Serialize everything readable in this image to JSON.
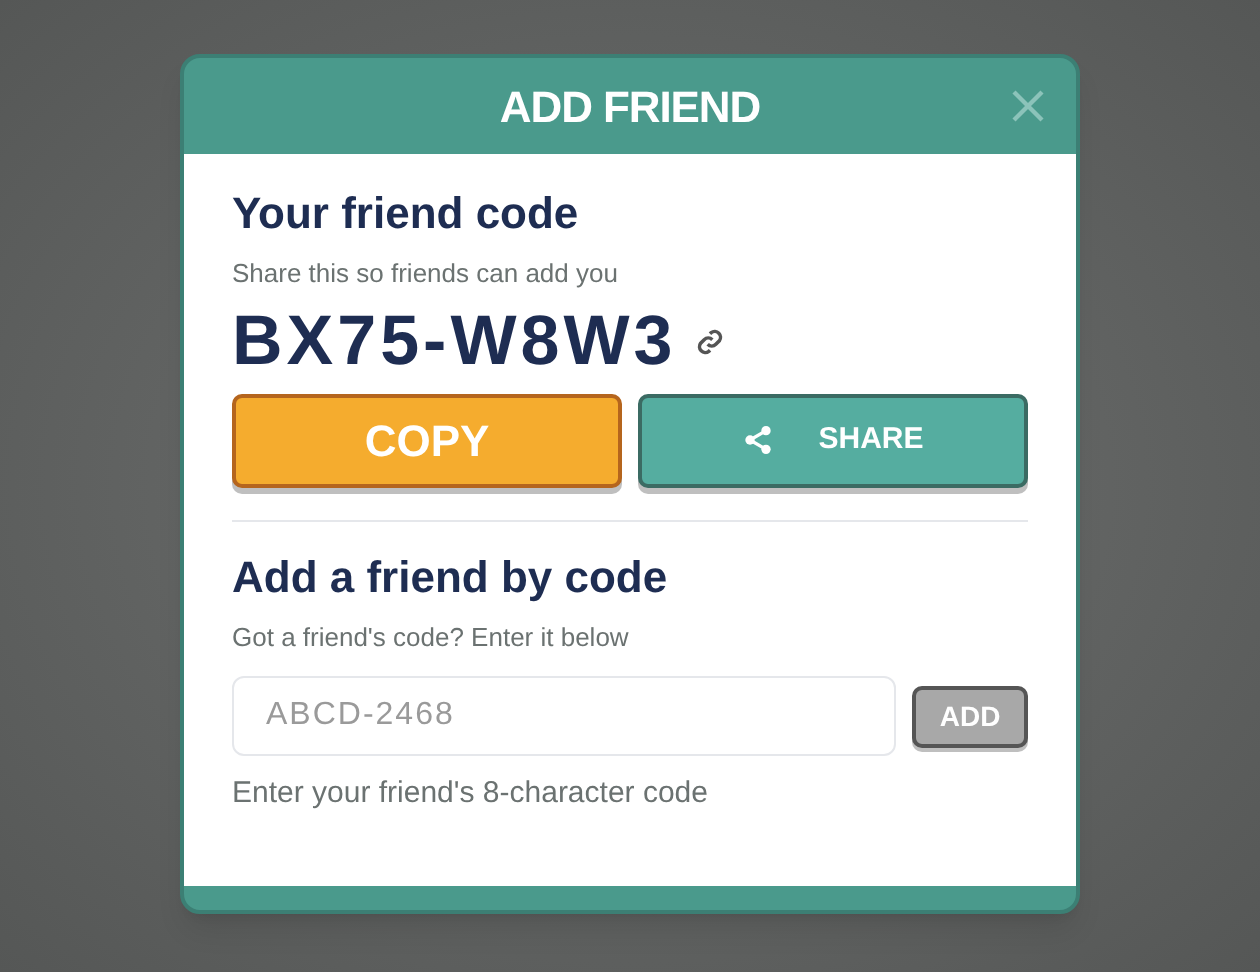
{
  "dialog": {
    "title": "ADD FRIEND"
  },
  "my_code": {
    "heading": "Your friend code",
    "hint": "Share this so friends can add you",
    "code": "BX75-W8W3"
  },
  "buttons": [
    {
      "label": "COPY",
      "kind": "copy"
    },
    {
      "label": "SHARE",
      "kind": "share"
    }
  ],
  "add_by_code": {
    "heading": "Add a friend by code",
    "hint": "Got a friend's code? Enter it below",
    "placeholder": "ABCD-2468",
    "button": {
      "label": "ADD",
      "disabled": true
    },
    "help": "Enter your friend's 8-character code"
  }
}
